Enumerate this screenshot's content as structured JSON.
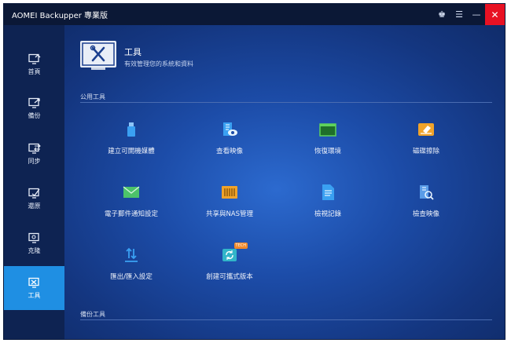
{
  "titlebar": {
    "app_title": "AOMEI Backupper 專業版",
    "icons": [
      "crown-icon",
      "menu-icon",
      "minimize-icon",
      "close-icon"
    ],
    "close_glyph": "✕",
    "menu_glyph": "☰",
    "minimize_glyph": "—",
    "crown_glyph": "♚"
  },
  "sidebar": {
    "items": [
      {
        "label": "首頁",
        "icon": "home-icon"
      },
      {
        "label": "備份",
        "icon": "backup-icon"
      },
      {
        "label": "同步",
        "icon": "sync-icon"
      },
      {
        "label": "還原",
        "icon": "restore-icon"
      },
      {
        "label": "克隆",
        "icon": "clone-icon"
      },
      {
        "label": "工具",
        "icon": "tools-icon",
        "active": true
      }
    ]
  },
  "header": {
    "title": "工具",
    "subtitle": "有效管理您的系統和資料"
  },
  "sections": {
    "common": "公用工具",
    "backup": "備份工具"
  },
  "tools": [
    {
      "label": "建立可開機媒體",
      "icon": "usb-drive-icon"
    },
    {
      "label": "查看映像",
      "icon": "view-image-icon"
    },
    {
      "label": "恢復環境",
      "icon": "recovery-env-icon"
    },
    {
      "label": "磁碟擦除",
      "icon": "disk-wipe-icon"
    },
    {
      "label": "電子郵件通知設定",
      "icon": "email-icon"
    },
    {
      "label": "共享與NAS管理",
      "icon": "nas-icon"
    },
    {
      "label": "檢視記錄",
      "icon": "log-icon"
    },
    {
      "label": "檢查映像",
      "icon": "check-image-icon"
    },
    {
      "label": "匯出/匯入設定",
      "icon": "export-import-icon"
    },
    {
      "label": "創建可攜式版本",
      "icon": "portable-icon",
      "badge": "TECH"
    }
  ],
  "colors": {
    "accent": "#1f8fe3",
    "sidebar": "#0e2352",
    "titlebar": "#0b1836",
    "close": "#e81123"
  }
}
